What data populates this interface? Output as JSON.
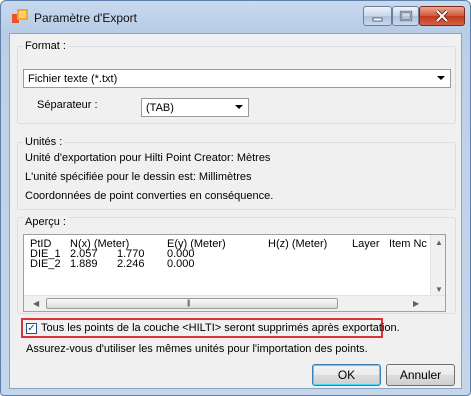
{
  "window": {
    "title": "Paramètre d'Export"
  },
  "format": {
    "group_label": "Format :",
    "selected": "Fichier texte (*.txt)",
    "separator_label": "Séparateur :",
    "separator_value": "(TAB)"
  },
  "units": {
    "group_label": "Unités :",
    "lines": [
      "Unité d'exportation pour Hilti Point Creator: Mètres",
      "L'unité spécifiée pour le dessin est: Millimètres",
      "Coordonnées de point converties en conséquence."
    ]
  },
  "preview": {
    "group_label": "Aperçu :",
    "columns": [
      "PtID",
      "N(x) (Meter)",
      "E(y) (Meter)",
      "H(z) (Meter)",
      "Layer",
      "Item Nc"
    ],
    "rows": [
      [
        "DIE_1",
        "2.057",
        "1.770",
        "0.000"
      ],
      [
        "DIE_2",
        "1.889",
        "2.246",
        "0.000"
      ]
    ]
  },
  "options": {
    "delete_points_label": "Tous les points de la couche <HILTI> seront supprimés après exportation.",
    "delete_points_checked": true,
    "units_note": "Assurez-vous d'utiliser les mêmes unités pour l'importation des points."
  },
  "buttons": {
    "ok": "OK",
    "cancel": "Annuler"
  },
  "colors": {
    "highlight_border": "#d9333a",
    "close_button": "#c2391b"
  }
}
